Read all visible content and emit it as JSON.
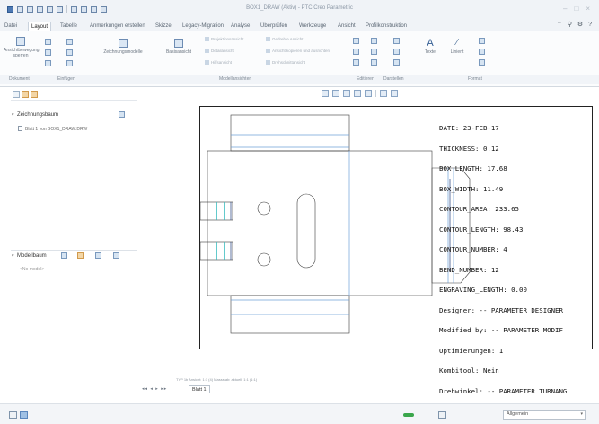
{
  "window": {
    "title": "BOX1_DRAW (Aktiv) - PTC Creo Parametric"
  },
  "tabs": [
    {
      "label": "Datei"
    },
    {
      "label": "Layout"
    },
    {
      "label": "Tabelle"
    },
    {
      "label": "Anmerkungen erstellen"
    },
    {
      "label": "Skizze"
    },
    {
      "label": "Legacy-Migration"
    },
    {
      "label": "Analyse"
    },
    {
      "label": "Überprüfen"
    },
    {
      "label": "Werkzeuge"
    },
    {
      "label": "Ansicht"
    },
    {
      "label": "Profilkonstruktion"
    }
  ],
  "ribbon": {
    "buttons": {
      "ansichten": "Ansichtbewegung sperren",
      "zeichnungsmodelle": "Zeichnungsmodelle",
      "basisansicht": "Basisansicht",
      "texte": "Texte",
      "linient": "Linient"
    },
    "modellansichten_items": [
      "Projektionsansicht",
      "Detailansicht",
      "Hilfsansicht",
      "Gedrehte Ansicht",
      "Ansicht kopieren und ausrichten",
      "Drehschnittansicht"
    ],
    "groups": [
      {
        "label": "Dokument"
      },
      {
        "label": "Einfügen"
      },
      {
        "label": "Modellansichten"
      },
      {
        "label": "Editieren"
      },
      {
        "label": "Darstellen"
      },
      {
        "label": "Format"
      }
    ]
  },
  "tree": {
    "drawing_tree_title": "Zeichnungsbaum",
    "drawing_tree_item": "Blatt 1 von BOX1_DRAW.DRW",
    "model_tree_title": "Modellbaum",
    "model_tree_item": "<No model>"
  },
  "drawing": {
    "meta_lines": [
      "DATE: 23-FEB-17",
      "THICKNESS: 0.12",
      "BOX_LENGTH: 17.68",
      "BOX_WIDTH: 11.49",
      "CONTOUR_AREA: 233.65",
      "CONTOUR_LENGTH: 98.43",
      "CONTOUR_NUMBER: 4",
      "BEND_NUMBER: 12",
      "ENGRAVING_LENGTH: 0.00",
      "Designer: -- PARAMETER DESIGNER",
      "Modified by: -- PARAMETER MODIF",
      "Optimierungen: 1",
      "Kombitool: Nein",
      "Drehwinkel: -- PARAMETER TURNANG"
    ],
    "footer_text": "TYP 1b    Ansicht: 1:1 (4)    Massstab: aktuell: 1:1 (1:1)",
    "sheet_nav": "◂◂ ◂ ▸ ▸▸",
    "sheet_tab": "Blatt 1"
  },
  "status": {
    "filter": "Allgemein"
  },
  "colors": {
    "accent": "#3a6fb0",
    "bend_line": "#6fa0d8",
    "teal": "#3cbcc0"
  }
}
